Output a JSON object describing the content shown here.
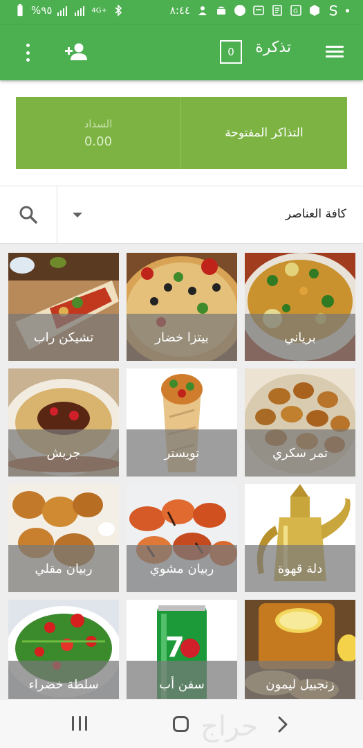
{
  "status_bar": {
    "time": "٨:٤٤",
    "battery_percent": "%٩٥",
    "network_label": "4G+",
    "accent": "#4caf50"
  },
  "toolbar": {
    "title": "تذكرة",
    "ticket_count": "0",
    "menu_icon": "hamburger-icon",
    "add_customer_icon": "person-add-icon",
    "more_icon": "more-vert-icon",
    "background": "#4caf50"
  },
  "actions": {
    "open_tickets_label": "التذاكر المفتوحة",
    "payment_label": "السداد",
    "payment_value": "0.00",
    "button_color": "#7cb342"
  },
  "filter": {
    "selected": "كافة العناصر",
    "search_icon": "search-icon"
  },
  "items": [
    {
      "name": "برياني",
      "image": "biryani-photo"
    },
    {
      "name": "بيتزا خضار",
      "image": "veg-pizza-photo"
    },
    {
      "name": "تشيكن راب",
      "image": "chicken-wrap-photo"
    },
    {
      "name": "تمر سكري",
      "image": "sukkari-dates-photo"
    },
    {
      "name": "تويستر",
      "image": "twister-photo"
    },
    {
      "name": "جريش",
      "image": "jareesh-photo"
    },
    {
      "name": "دلة قهوة",
      "image": "coffee-dallah-photo"
    },
    {
      "name": "ربيان مشوي",
      "image": "grilled-shrimp-photo"
    },
    {
      "name": "ربيان مقلي",
      "image": "fried-shrimp-photo"
    },
    {
      "name": "زنجبيل ليمون",
      "image": "ginger-lemon-photo"
    },
    {
      "name": "سفن أب",
      "image": "7up-can-photo"
    },
    {
      "name": "سلطة خضراء",
      "image": "green-salad-photo"
    }
  ],
  "nav_bar": {
    "recent_icon": "recent-apps-icon",
    "home_icon": "home-icon",
    "back_icon": "back-icon",
    "watermark": "حراج"
  }
}
